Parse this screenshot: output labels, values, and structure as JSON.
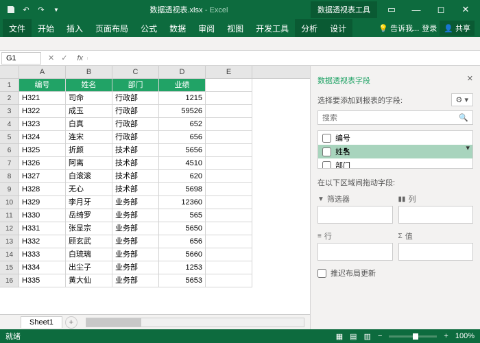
{
  "titlebar": {
    "filename": "数据透视表.xlsx",
    "app": "Excel",
    "context": "数据透视表工具"
  },
  "tabs": {
    "file": "文件",
    "list": [
      "开始",
      "插入",
      "页面布局",
      "公式",
      "数据",
      "审阅",
      "视图",
      "开发工具"
    ],
    "ctx": [
      "分析",
      "设计"
    ],
    "tell": "告诉我...",
    "login": "登录",
    "share": "共享"
  },
  "nameBox": "G1",
  "columns": [
    "A",
    "B",
    "C",
    "D",
    "E"
  ],
  "headers": [
    "编号",
    "姓名",
    "部门",
    "业绩"
  ],
  "rows": [
    [
      "H321",
      "司命",
      "行政部",
      "1215"
    ],
    [
      "H322",
      "成玉",
      "行政部",
      "59526"
    ],
    [
      "H323",
      "白真",
      "行政部",
      "652"
    ],
    [
      "H324",
      "连宋",
      "行政部",
      "656"
    ],
    [
      "H325",
      "折颜",
      "技术部",
      "5656"
    ],
    [
      "H326",
      "阿离",
      "技术部",
      "4510"
    ],
    [
      "H327",
      "白滚滚",
      "技术部",
      "620"
    ],
    [
      "H328",
      "无心",
      "技术部",
      "5698"
    ],
    [
      "H329",
      "李月牙",
      "业务部",
      "12360"
    ],
    [
      "H330",
      "岳绮罗",
      "业务部",
      "565"
    ],
    [
      "H331",
      "张显宗",
      "业务部",
      "5650"
    ],
    [
      "H332",
      "顾玄武",
      "业务部",
      "656"
    ],
    [
      "H333",
      "白琉璃",
      "业务部",
      "5660"
    ],
    [
      "H334",
      "出尘子",
      "业务部",
      "1253"
    ],
    [
      "H335",
      "黄大仙",
      "业务部",
      "5653"
    ]
  ],
  "sheet": "Sheet1",
  "pane": {
    "title": "数据透视表字段",
    "sub": "选择要添加到报表的字段:",
    "search": "搜索",
    "fields": [
      "编号",
      "姓名",
      "部门"
    ],
    "areasLabel": "在以下区域间拖动字段:",
    "filter": "筛选器",
    "cols": "列",
    "rowsL": "行",
    "vals": "值",
    "defer": "推迟布局更新"
  },
  "status": {
    "ready": "就绪",
    "zoom": "100%"
  }
}
